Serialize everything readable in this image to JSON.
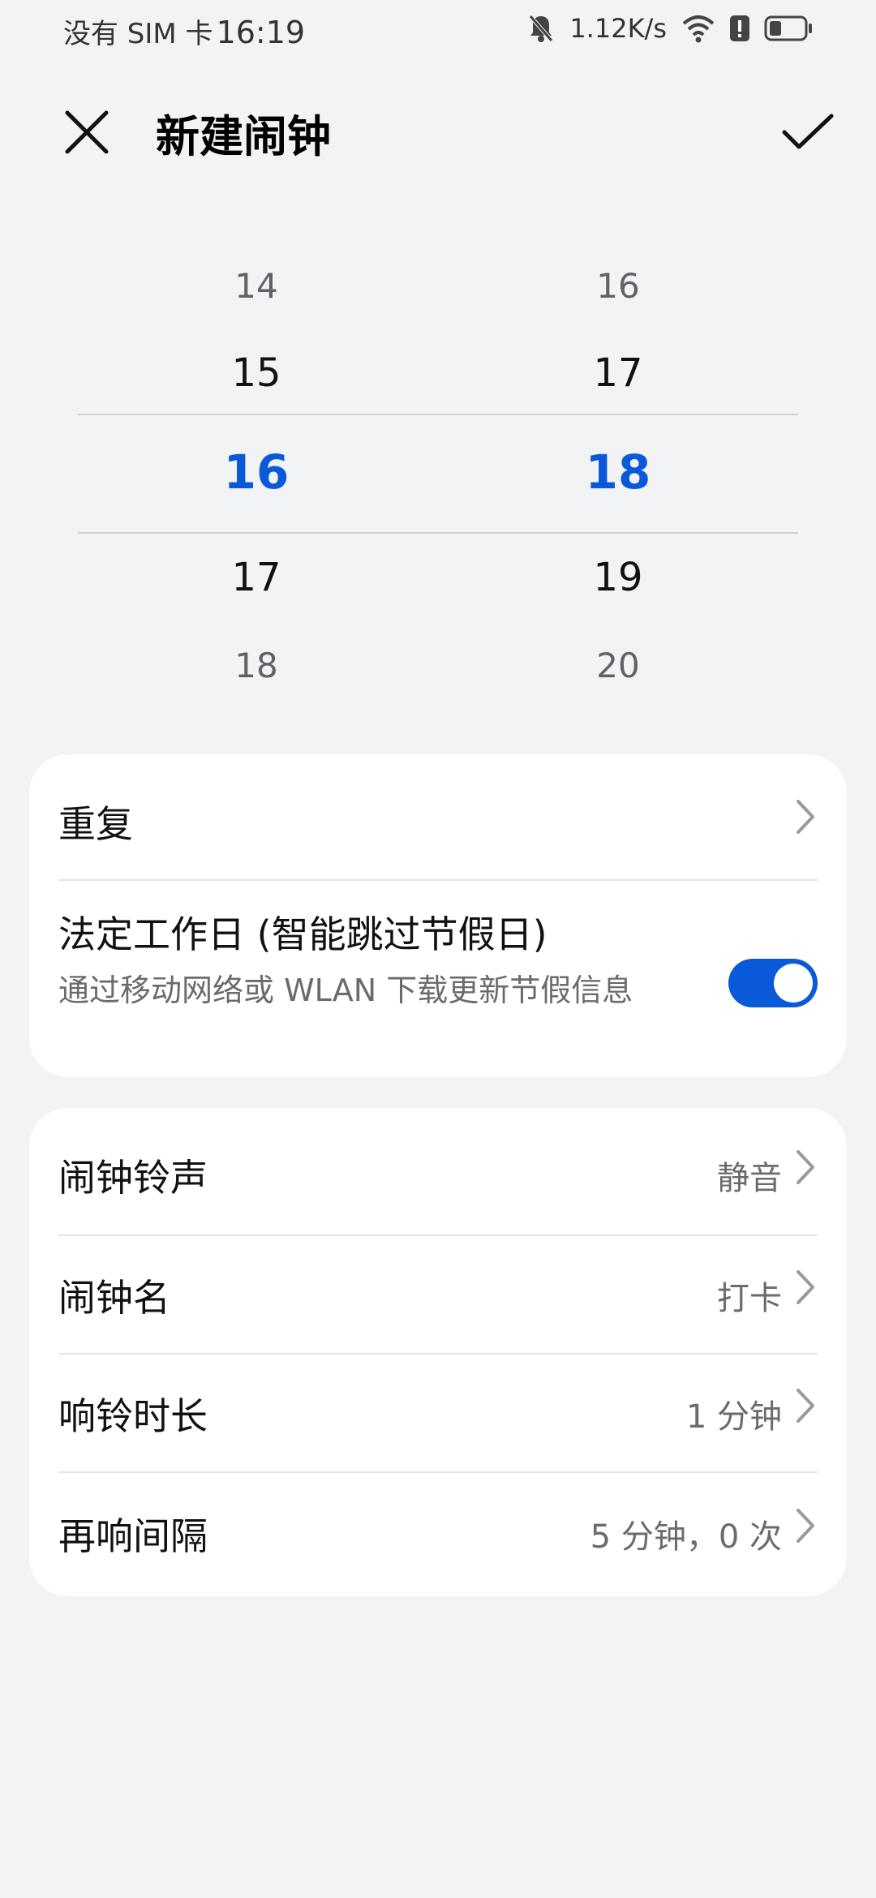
{
  "status_bar": {
    "sim": "没有 SIM 卡",
    "time": "16:19",
    "net_speed": "1.12K/s"
  },
  "header": {
    "title": "新建闹钟"
  },
  "picker": {
    "hours": [
      "14",
      "15",
      "16",
      "17",
      "18"
    ],
    "minutes": [
      "16",
      "17",
      "18",
      "19",
      "20"
    ],
    "selected_hour": "16",
    "selected_minute": "18",
    "accent_color": "#0a59d8"
  },
  "repeat": {
    "label": "重复"
  },
  "workday": {
    "label": "法定工作日 (智能跳过节假日)",
    "description": "通过移动网络或 WLAN 下载更新节假信息",
    "enabled": true
  },
  "settings": [
    {
      "label": "闹钟铃声",
      "value": "静音"
    },
    {
      "label": "闹钟名",
      "value": "打卡"
    },
    {
      "label": "响铃时长",
      "value": "1 分钟"
    },
    {
      "label": "再响间隔",
      "value": "5 分钟，0 次"
    }
  ]
}
